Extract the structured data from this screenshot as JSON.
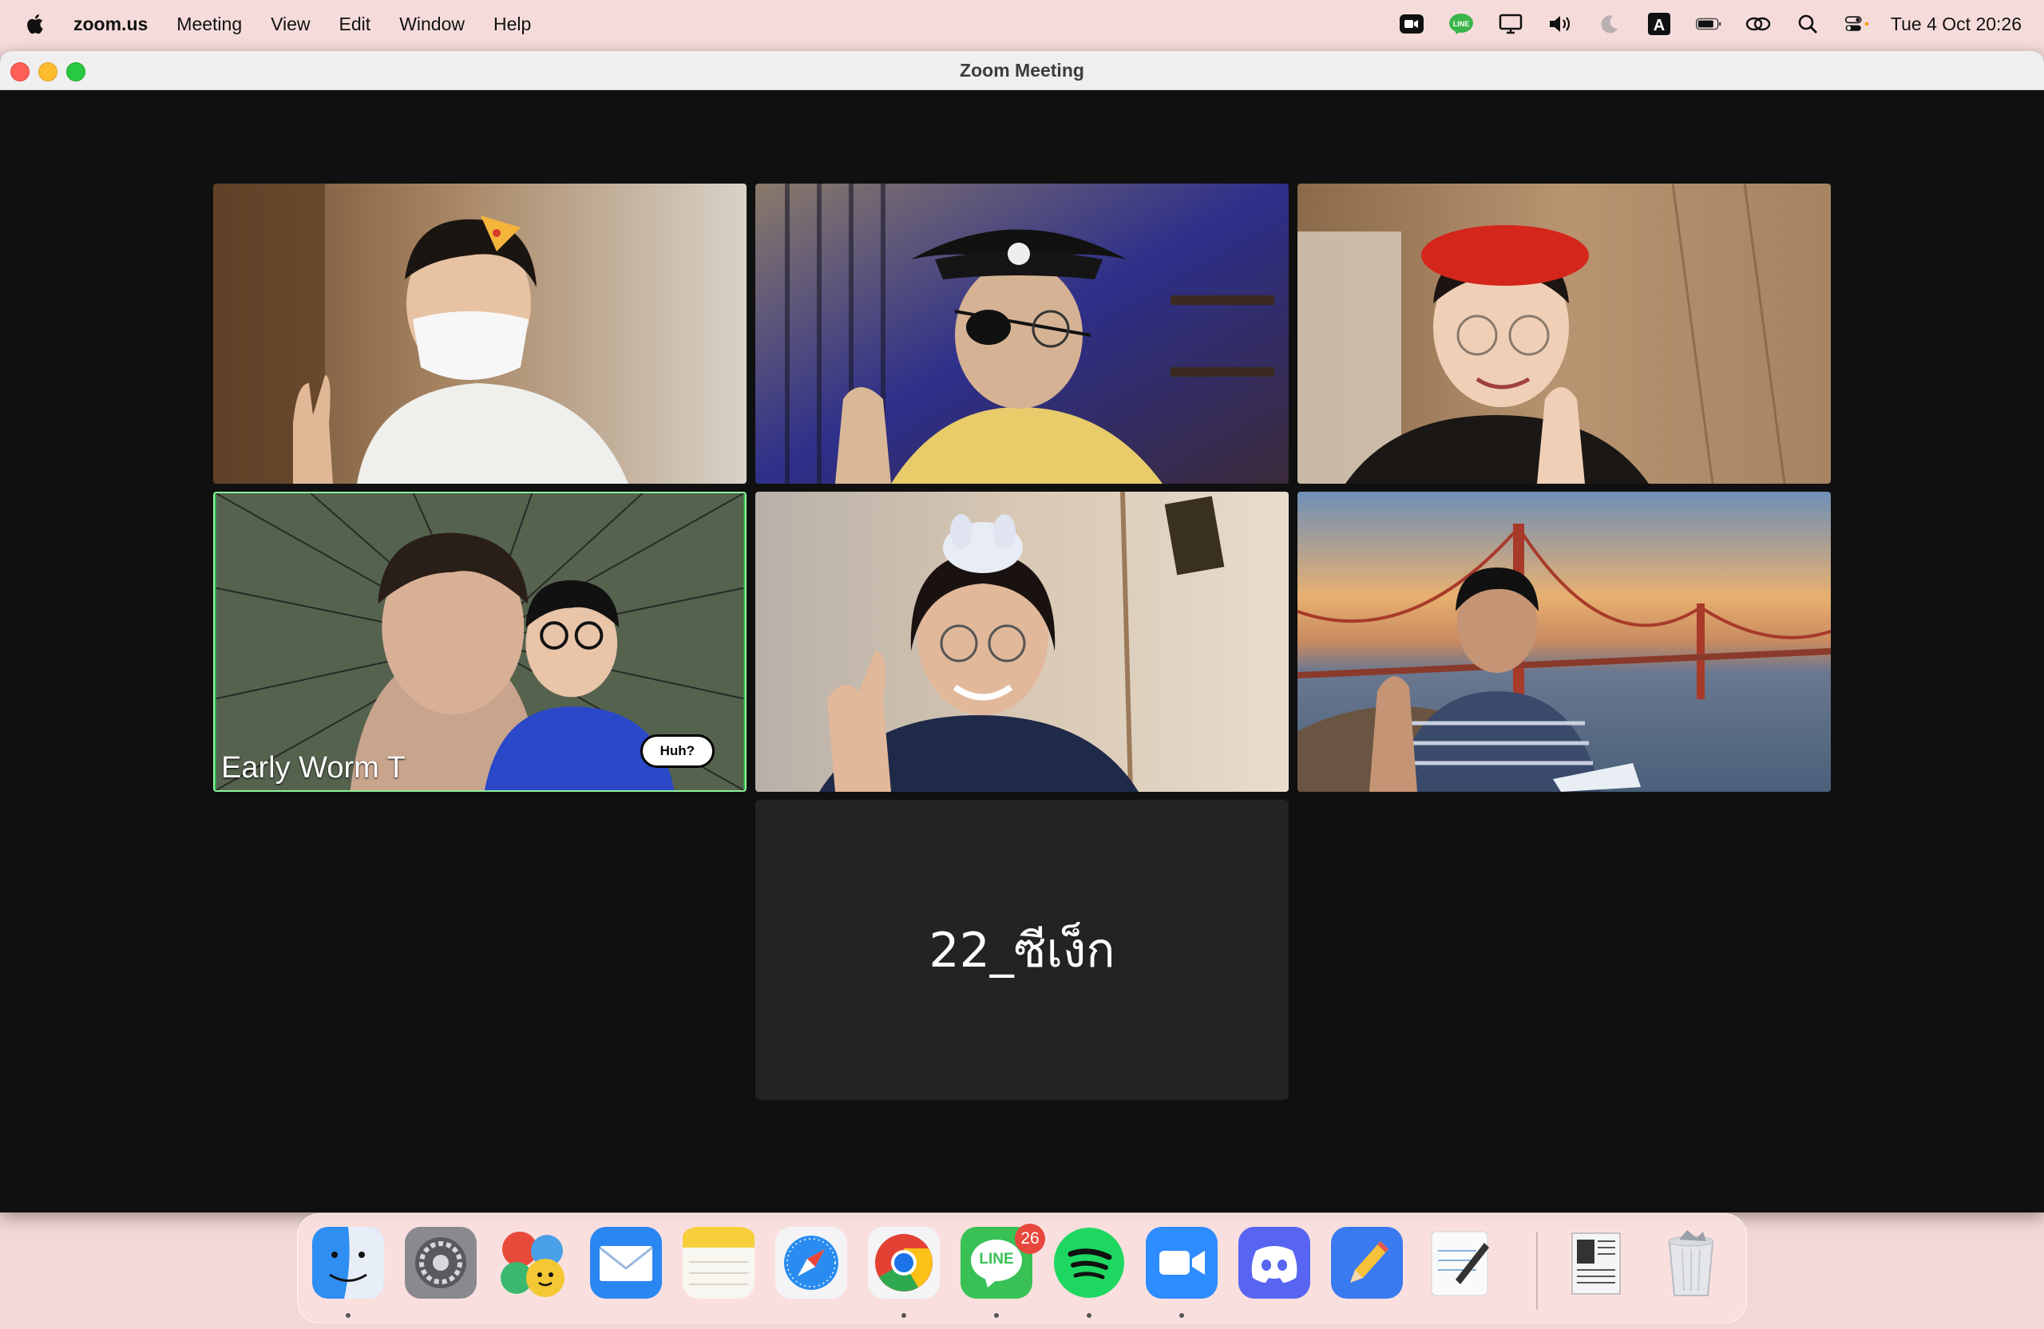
{
  "menubar": {
    "app_name": "zoom.us",
    "items": [
      "Meeting",
      "View",
      "Edit",
      "Window",
      "Help"
    ],
    "clock": "Tue 4 Oct  20:26",
    "status_icons": [
      "zoom-icon",
      "line-icon",
      "display-icon",
      "volume-icon",
      "moon-icon",
      "input-source-icon",
      "battery-icon",
      "link-icon",
      "search-icon",
      "control-center-icon"
    ]
  },
  "window": {
    "title": "Zoom Meeting"
  },
  "participants": [
    {
      "scene": "masked young man with party hat making peace sign"
    },
    {
      "scene": "person in pirate hat and eyepatch giving thumbs up"
    },
    {
      "scene": "person in red beret winking with peace sign"
    },
    {
      "scene": "two people with manga speed-lines background",
      "name": "Early Worm T",
      "bubble": "Huh?",
      "active_speaker": true
    },
    {
      "scene": "smiling girl with bunny headband making peace sign"
    },
    {
      "scene": "boy in striped shirt with bridge background"
    },
    {
      "label": "22_ซีเง็ก",
      "video_off": true
    }
  ],
  "dock": {
    "apps": [
      "finder-icon",
      "system-preferences-icon",
      "game-center-icon",
      "mail-icon",
      "notes-icon",
      "safari-icon",
      "chrome-icon",
      "line-icon",
      "spotify-icon",
      "zoom-icon",
      "discord-icon",
      "pages-icon",
      "textedit-icon",
      "news-document-icon",
      "trash-icon"
    ],
    "line_badge": "26",
    "line_label": "LINE",
    "running": [
      "finder",
      "chrome",
      "line",
      "spotify",
      "zoom"
    ]
  }
}
